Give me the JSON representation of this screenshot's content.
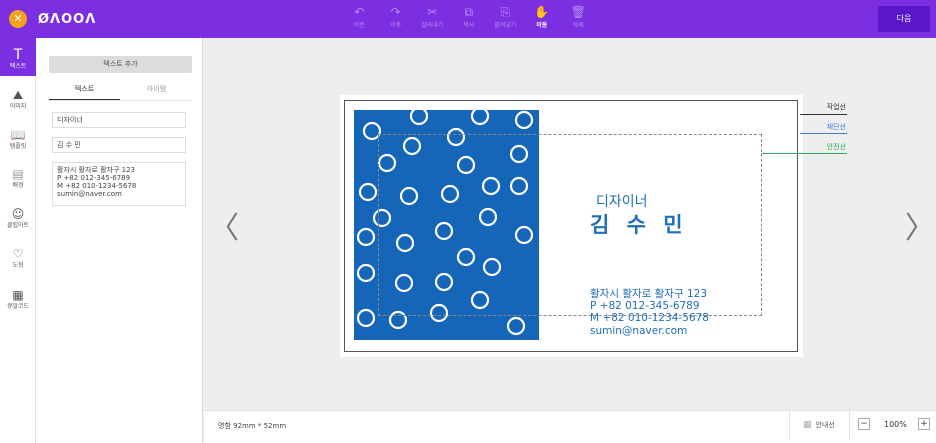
{
  "topbar": {
    "close_glyph": "✕",
    "logo": "ØɅOOɅ",
    "tools": [
      {
        "icon": "undo-icon",
        "glyph": "↶",
        "label": "이전"
      },
      {
        "icon": "redo-icon",
        "glyph": "↷",
        "label": "이후"
      },
      {
        "icon": "cut-icon",
        "glyph": "✂",
        "label": "잘라내기"
      },
      {
        "icon": "copy-icon",
        "glyph": "⧉",
        "label": "복사"
      },
      {
        "icon": "paste-icon",
        "glyph": "⎘",
        "label": "붙여넣기"
      },
      {
        "icon": "hand-icon",
        "glyph": "✋",
        "label": "이동"
      },
      {
        "icon": "trash-icon",
        "glyph": "🗑",
        "label": "삭제"
      }
    ],
    "next_label": "다음"
  },
  "rail": [
    {
      "icon": "text-icon",
      "glyph": "T",
      "label": "텍스트"
    },
    {
      "icon": "image-icon",
      "glyph": "⛰",
      "label": "이미지"
    },
    {
      "icon": "template-icon",
      "glyph": "📖",
      "label": "템플릿"
    },
    {
      "icon": "background-icon",
      "glyph": "▤",
      "label": "배경"
    },
    {
      "icon": "clipart-icon",
      "glyph": "☺",
      "label": "클립아트"
    },
    {
      "icon": "shape-icon",
      "glyph": "♡",
      "label": "도형"
    },
    {
      "icon": "qrcode-icon",
      "glyph": "▦",
      "label": "큐알코드"
    }
  ],
  "panel": {
    "add_text_label": "텍스트 추가",
    "tabs": [
      "텍스트",
      "아이템"
    ],
    "fields": {
      "job": "디자이너",
      "name": "김 수 민",
      "info": "활자시 활자로 활자구 123\nP +82 012-345-6789\nM +82 010-1234-5678\nsumin@naver.com"
    }
  },
  "card": {
    "job": "디자이너",
    "name": "김 수 민",
    "info": "활자시 활자로 활자구 123\nP +82 012-345-6789\nM +82 010-1234-5678\nsumin@naver.com",
    "pattern_color": "#1565b8",
    "text_color": "#1f6fb8"
  },
  "guides": {
    "work": {
      "label": "작업선",
      "color": "#333333"
    },
    "cut": {
      "label": "재단선",
      "color": "#3d7fd6"
    },
    "safe": {
      "label": "안전선",
      "color": "#2eaa5a"
    }
  },
  "nav": {
    "prev_glyph": "〈",
    "next_glyph": "〉"
  },
  "bottombar": {
    "size_label": "명함 92mm * 52mm",
    "guide_toggle_label": "안내선",
    "zoom_minus": "−",
    "zoom_value": "100%",
    "zoom_plus": "+"
  },
  "colors": {
    "accent": "#7b2fe0",
    "close": "#f7a21b",
    "next_button": "#5a17c9"
  }
}
